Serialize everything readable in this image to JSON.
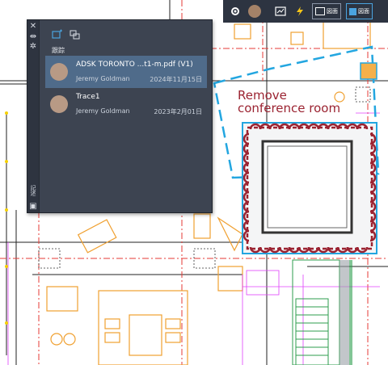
{
  "colors": {
    "panel_bg": "#3d4451",
    "selected_row": "#4f6b8a",
    "toolbar_bg": "#2d3441",
    "markup_red": "#9b2331",
    "markup_blue": "#23a6e0",
    "drawing_red": "#e53935",
    "drawing_orange": "#f0a030",
    "drawing_magenta": "#e040fb",
    "drawing_green": "#2e9e4e"
  },
  "toolbar": {
    "icons": [
      "gear-icon",
      "avatar",
      "grid-icon",
      "lightning-icon",
      "layout-icon",
      "panel-icon"
    ],
    "btn1_label": "図面",
    "btn2_label": "図面"
  },
  "panel": {
    "rail_icons": [
      "close-icon",
      "pin-icon",
      "settings-icon"
    ],
    "rail_label": "記述",
    "header_icons": [
      "add-trace-icon",
      "import-trace-icon"
    ],
    "section_label": "跟踪",
    "traces": [
      {
        "title": "ADSK TORONTO ...t1-m.pdf (V1)",
        "user": "Jeremy Goldman",
        "date": "2024年11月15日",
        "selected": true
      },
      {
        "title": "Trace1",
        "user": "Jeremy Goldman",
        "date": "2023年2月01日",
        "selected": false
      }
    ]
  },
  "markup": {
    "line1": "Remove",
    "line2": "conference room"
  }
}
